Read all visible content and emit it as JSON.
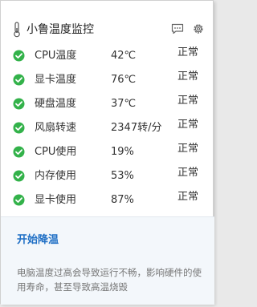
{
  "header": {
    "title": "小鲁温度监控",
    "icons": {
      "left": "thermometer-icon",
      "chat": "chat-icon",
      "settings": "gear-icon"
    }
  },
  "metrics": [
    {
      "label": "CPU温度",
      "value": "42℃",
      "status": "正常"
    },
    {
      "label": "显卡温度",
      "value": "76℃",
      "status": "正常"
    },
    {
      "label": "硬盘温度",
      "value": "37℃",
      "status": "正常"
    },
    {
      "label": "风扇转速",
      "value": "2347转/分",
      "status": "正常"
    },
    {
      "label": "CPU使用",
      "value": "19%",
      "status": "正常"
    },
    {
      "label": "内存使用",
      "value": "53%",
      "status": "正常"
    },
    {
      "label": "显卡使用",
      "value": "87%",
      "status": "正常"
    }
  ],
  "footer": {
    "action_label": "开始降温",
    "warning_text": "电脑温度过高会导致运行不畅，影响硬件的使用寿命，甚至导致高温烧毁"
  },
  "colors": {
    "check_green": "#33b24a",
    "link_blue": "#1f6fc5",
    "footer_bg": "#f3f7fb"
  }
}
